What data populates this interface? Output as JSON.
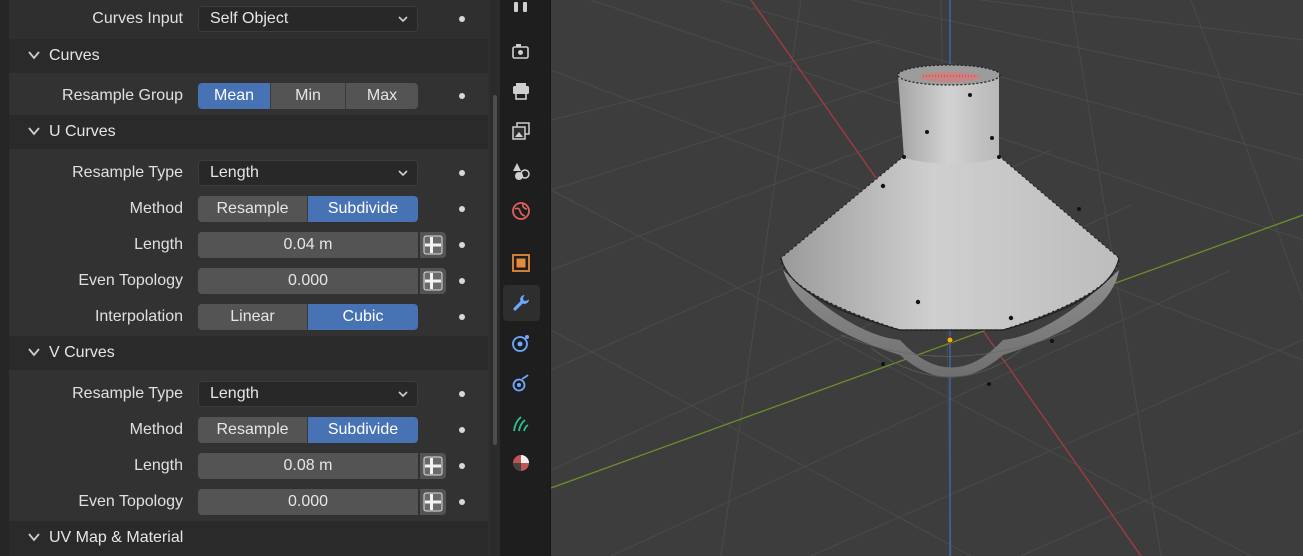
{
  "properties": {
    "curves_input": {
      "label": "Curves Input",
      "value": "Self Object"
    },
    "curves_header": {
      "title": "Curves"
    },
    "resample_group": {
      "label": "Resample Group",
      "options": [
        "Mean",
        "Min",
        "Max"
      ],
      "selected": "Mean"
    },
    "u_curves": {
      "title": "U Curves",
      "resample_type": {
        "label": "Resample Type",
        "value": "Length"
      },
      "method": {
        "label": "Method",
        "options": [
          "Resample",
          "Subdivide"
        ],
        "selected": "Subdivide"
      },
      "length": {
        "label": "Length",
        "value": "0.04 m"
      },
      "even_topology": {
        "label": "Even Topology",
        "value": "0.000"
      },
      "interpolation": {
        "label": "Interpolation",
        "options": [
          "Linear",
          "Cubic"
        ],
        "selected": "Cubic"
      }
    },
    "v_curves": {
      "title": "V Curves",
      "resample_type": {
        "label": "Resample Type",
        "value": "Length"
      },
      "method": {
        "label": "Method",
        "options": [
          "Resample",
          "Subdivide"
        ],
        "selected": "Subdivide"
      },
      "length": {
        "label": "Length",
        "value": "0.08 m"
      },
      "even_topology": {
        "label": "Even Topology",
        "value": "0.000"
      }
    },
    "uv_map_header": {
      "title": "UV Map & Material"
    }
  },
  "property_tabs": [
    {
      "icon": "tool-icon"
    },
    {
      "icon": "render-icon"
    },
    {
      "icon": "output-icon"
    },
    {
      "icon": "view-layer-icon"
    },
    {
      "icon": "scene-icon"
    },
    {
      "icon": "world-icon"
    },
    {
      "icon": "object-icon"
    },
    {
      "icon": "modifier-wrench-icon",
      "active": true
    },
    {
      "icon": "particles-icon"
    },
    {
      "icon": "physics-icon"
    },
    {
      "icon": "constraints-icon"
    },
    {
      "icon": "material-icon"
    }
  ],
  "colors": {
    "accent": "#4772b3",
    "panel_bg": "#2f2f2f",
    "viewport_bg": "#3d3d3d",
    "x_axis": "#a33b45",
    "y_axis": "#6c8f26",
    "z_axis": "#3f6fc2",
    "active_tab_icon": "#6fa8ff"
  }
}
